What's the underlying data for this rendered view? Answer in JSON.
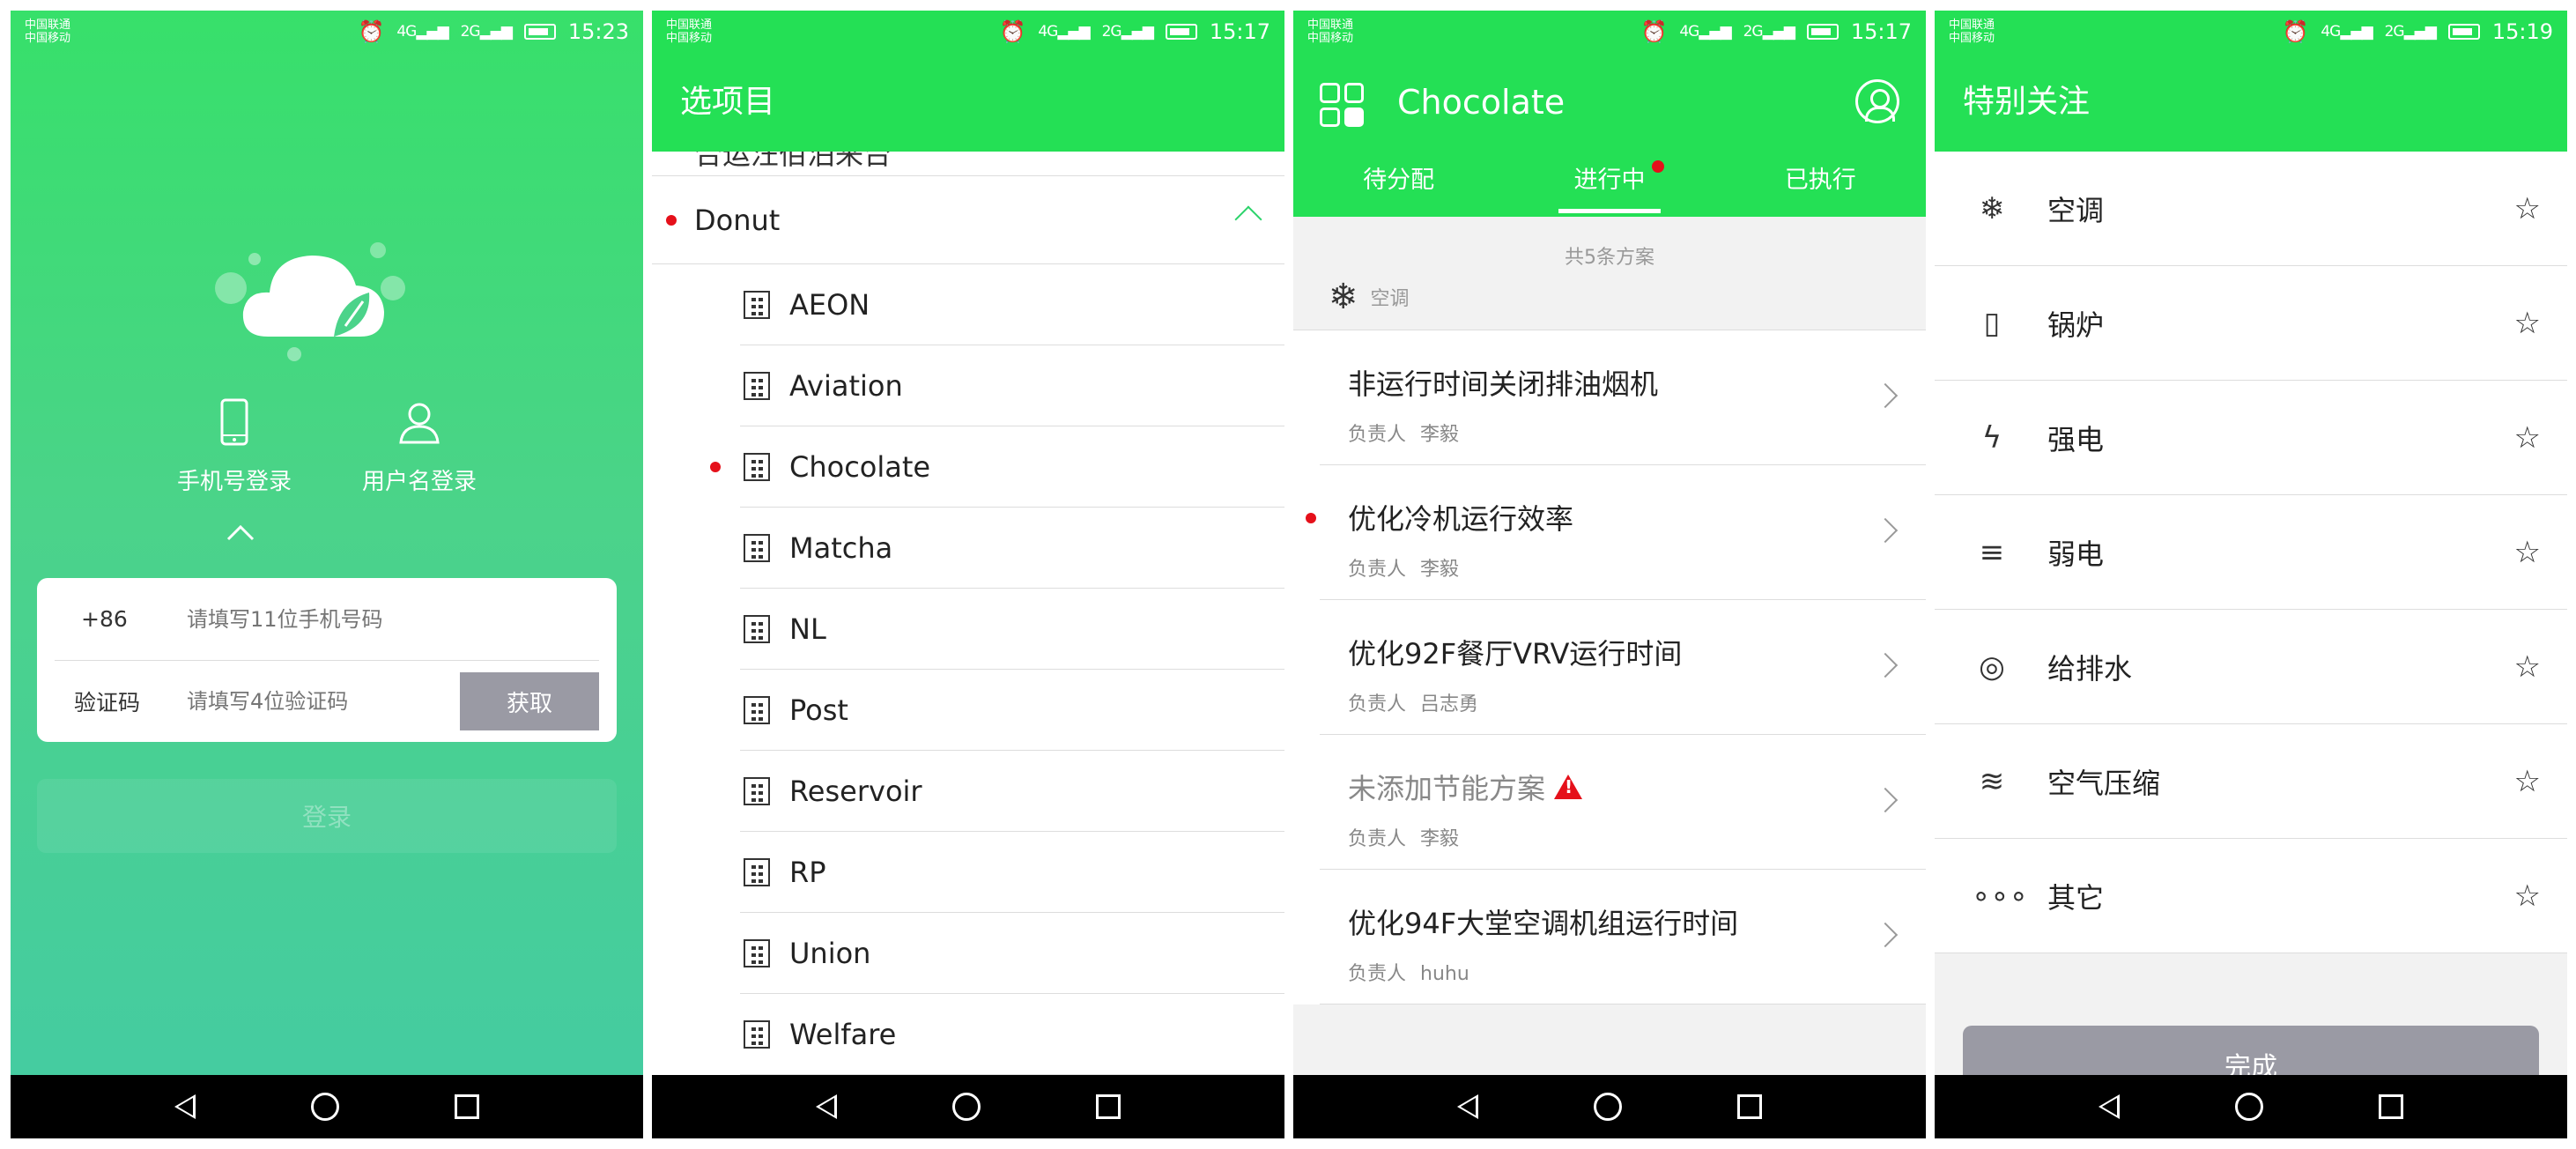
{
  "status_bar": {
    "carrier_1": "中国联通",
    "carrier_2": "中国移动",
    "signal_4g": "4G",
    "signal_2g": "2G",
    "times": [
      "15:23",
      "15:17",
      "15:17",
      "15:19"
    ]
  },
  "login_screen": {
    "tabs": [
      {
        "label": "手机号登录",
        "icon": "phone-icon"
      },
      {
        "label": "用户名登录",
        "icon": "user-icon"
      }
    ],
    "country_code": "+86",
    "phone_placeholder": "请填写11位手机号码",
    "code_label": "验证码",
    "code_placeholder": "请填写4位验证码",
    "get_code_button": "获取",
    "login_button": "登录"
  },
  "project_screen": {
    "title": "选项目",
    "partial_top_item": "合运汪佰泊来台",
    "group": "Donut",
    "items": [
      "AEON",
      "Aviation",
      "Chocolate",
      "Matcha",
      "NL",
      "Post",
      "Reservoir",
      "RP",
      "Union",
      "Welfare"
    ]
  },
  "plans_screen": {
    "title": "Chocolate",
    "tabs": [
      "待分配",
      "进行中",
      "已执行"
    ],
    "count_text": "共5条方案",
    "category": "空调",
    "owner_label": "负责人",
    "plans": [
      {
        "title": "非运行时间关闭排油烟机",
        "owner": "李毅"
      },
      {
        "title": "优化冷机运行效率",
        "owner": "李毅"
      },
      {
        "title": "优化92F餐厅VRV运行时间",
        "owner": "吕志勇"
      },
      {
        "title": "未添加节能方案",
        "owner": "李毅"
      },
      {
        "title": "优化94F大堂空调机组运行时间",
        "owner": "huhu"
      }
    ]
  },
  "follow_screen": {
    "title": "特别关注",
    "items": [
      {
        "label": "空调",
        "icon": "snowflake-icon"
      },
      {
        "label": "锅炉",
        "icon": "boiler-icon"
      },
      {
        "label": "强电",
        "icon": "lightning-icon"
      },
      {
        "label": "弱电",
        "icon": "sliders-icon"
      },
      {
        "label": "给排水",
        "icon": "water-meter-icon"
      },
      {
        "label": "空气压缩",
        "icon": "wind-icon"
      },
      {
        "label": "其它",
        "icon": "more-icon"
      }
    ],
    "done_button": "完成"
  },
  "colors": {
    "brand_green": "#24e055",
    "alert_red": "#e5101a",
    "disabled_gray": "#9a9aa4"
  }
}
